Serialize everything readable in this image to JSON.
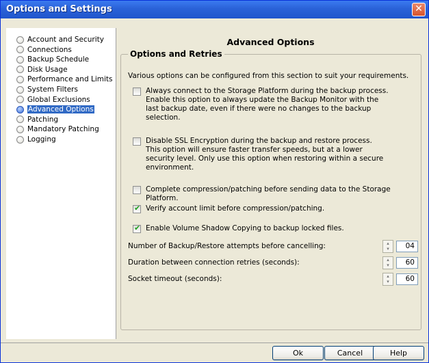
{
  "window": {
    "title": "Options and Settings",
    "close_glyph": "✕"
  },
  "sidebar": {
    "items": [
      {
        "label": "Account and Security",
        "selected": false
      },
      {
        "label": "Connections",
        "selected": false
      },
      {
        "label": "Backup Schedule",
        "selected": false
      },
      {
        "label": "Disk Usage",
        "selected": false
      },
      {
        "label": "Performance and Limits",
        "selected": false
      },
      {
        "label": "System Filters",
        "selected": false
      },
      {
        "label": "Global Exclusions",
        "selected": false
      },
      {
        "label": "Advanced Options",
        "selected": true
      },
      {
        "label": "Patching",
        "selected": false
      },
      {
        "label": "Mandatory Patching",
        "selected": false
      },
      {
        "label": "Logging",
        "selected": false
      }
    ]
  },
  "panel": {
    "title": "Advanced Options",
    "group_title": "Options and Retries",
    "intro": "Various options can be configured from this section to suit your requirements.",
    "options": [
      {
        "checked": false,
        "lines": [
          "Always connect to the Storage Platform during the backup process.",
          "Enable this option to always update the Backup Monitor with the",
          "last backup date, even if there were no changes to the backup",
          "selection."
        ]
      },
      {
        "checked": false,
        "lines": [
          "Disable SSL Encryption during the backup and restore process.",
          "This option will ensure faster transfer speeds, but at a lower",
          "security level. Only use this option when restoring within a secure",
          "environment."
        ]
      },
      {
        "checked": false,
        "lines": [
          "Complete compression/patching before sending data to the Storage Platform."
        ]
      },
      {
        "checked": true,
        "lines": [
          "Verify account limit before compression/patching."
        ]
      },
      {
        "checked": true,
        "lines": [
          "Enable Volume Shadow Copying to backup locked files."
        ]
      }
    ],
    "numeric": [
      {
        "label": "Number of Backup/Restore attempts before cancelling:",
        "value": "04"
      },
      {
        "label": "Duration between connection retries (seconds):",
        "value": "60"
      },
      {
        "label": "Socket timeout (seconds):",
        "value": "60"
      }
    ]
  },
  "buttons": {
    "ok": "Ok",
    "cancel": "Cancel",
    "help": "Help"
  },
  "colors": {
    "titlebar": "#2a62d8",
    "selection": "#316ac5",
    "checkmark": "#21a121"
  }
}
